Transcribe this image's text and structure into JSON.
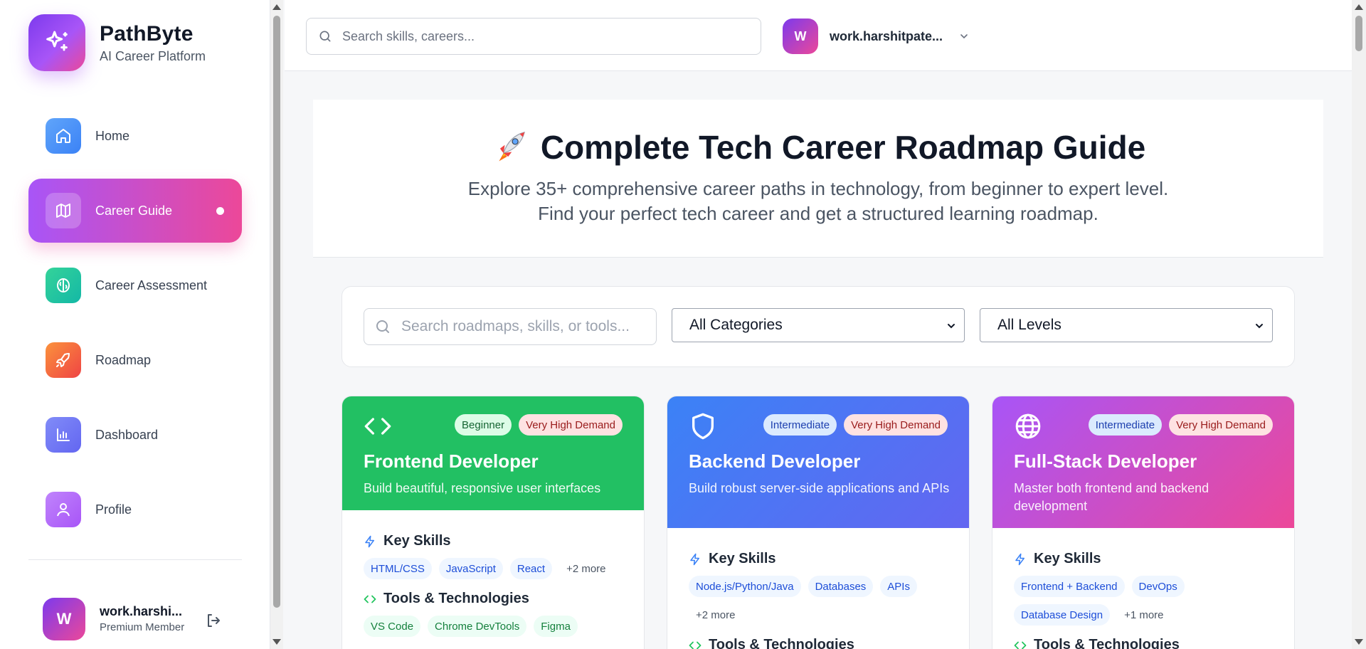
{
  "brand": {
    "name": "PathByte",
    "subtitle": "AI Career Platform"
  },
  "sidebar": {
    "items": [
      {
        "label": "Home",
        "icon": "home-icon",
        "color": "#3b82f6"
      },
      {
        "label": "Career Guide",
        "icon": "map-icon",
        "active": true
      },
      {
        "label": "Career Assessment",
        "icon": "brain-icon",
        "color": "#14b8a6"
      },
      {
        "label": "Roadmap",
        "icon": "rocket-icon",
        "color": "#f97316"
      },
      {
        "label": "Dashboard",
        "icon": "bar-chart-icon",
        "color": "#6366f1"
      },
      {
        "label": "Profile",
        "icon": "user-icon",
        "color": "#a855f7"
      }
    ],
    "user": {
      "initial": "W",
      "name": "work.harshi...",
      "tier": "Premium Member"
    }
  },
  "topbar": {
    "search_placeholder": "Search skills, careers...",
    "user_initial": "W",
    "username": "work.harshitpate..."
  },
  "hero": {
    "title": "Complete Tech Career Roadmap Guide",
    "description": "Explore 35+ comprehensive career paths in technology, from beginner to expert level. Find your perfect tech career and get a structured learning roadmap."
  },
  "filters": {
    "search_placeholder": "Search roadmaps, skills, or tools...",
    "category": "All Categories",
    "level": "All Levels"
  },
  "cards": [
    {
      "title": "Frontend Developer",
      "description": "Build beautiful, responsive user interfaces",
      "level": "Beginner",
      "demand": "Very High Demand",
      "skills_heading": "Key Skills",
      "skills": [
        "HTML/CSS",
        "JavaScript",
        "React"
      ],
      "skills_more": "+2 more",
      "tools_heading": "Tools & Technologies",
      "tools": [
        "VS Code",
        "Chrome DevTools",
        "Figma"
      ]
    },
    {
      "title": "Backend Developer",
      "description": "Build robust server-side applications and APIs",
      "level": "Intermediate",
      "demand": "Very High Demand",
      "skills_heading": "Key Skills",
      "skills": [
        "Node.js/Python/Java",
        "Databases",
        "APIs"
      ],
      "skills_more": "+2 more",
      "tools_heading": "Tools & Technologies"
    },
    {
      "title": "Full-Stack Developer",
      "description": "Master both frontend and backend development",
      "level": "Intermediate",
      "demand": "Very High Demand",
      "skills_heading": "Key Skills",
      "skills": [
        "Frontend + Backend",
        "DevOps",
        "Database Design"
      ],
      "skills_more": "+1 more",
      "tools_heading": "Tools & Technologies"
    }
  ]
}
